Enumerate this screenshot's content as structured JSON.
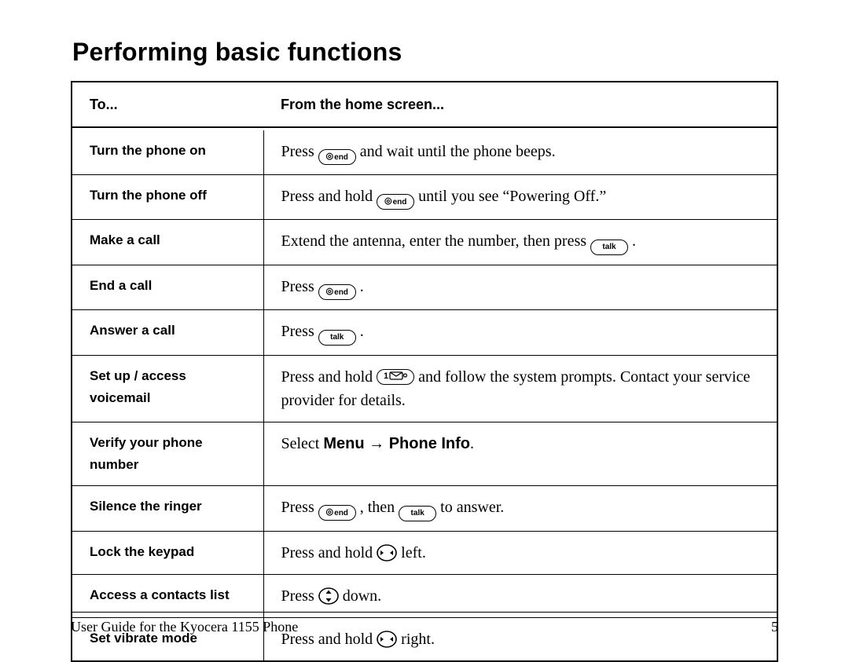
{
  "title": "Performing basic functions",
  "table": {
    "head": {
      "left": "To...",
      "right": "From the home screen..."
    },
    "rows": [
      {
        "lead": "Turn the phone on",
        "desc_pre": "Press ",
        "key1": "end",
        "desc_post": " and wait until the phone beeps."
      },
      {
        "lead": "Turn the phone off",
        "desc_pre": "Press and hold ",
        "key1": "end",
        "desc_post": " until you see “Powering Off.”"
      },
      {
        "lead": "Make a call",
        "desc_pre": "Extend the antenna, enter the number, then press ",
        "key1": "talk",
        "desc_post": " ."
      },
      {
        "lead": "End a call",
        "desc_pre": "Press ",
        "key1": "end",
        "desc_post": " ."
      },
      {
        "lead": "Answer a call",
        "desc_pre": "Press ",
        "key1": "talk",
        "desc_post": " ."
      },
      {
        "lead": "Set up / access voicemail",
        "desc_pre": "Press and hold ",
        "key1": "msg",
        "desc_post": " and follow the system prompts. Contact your service provider for details."
      },
      {
        "lead": "Verify your phone number",
        "plain_pre": "Select ",
        "bold": "Menu → Phone Info",
        "plain_post": "."
      },
      {
        "lead": "Silence the ringer",
        "desc_pre": "Press ",
        "key1": "end",
        "mid": " , then ",
        "key2": "talk",
        "desc_post": " to answer."
      },
      {
        "lead": "Lock the keypad",
        "desc_pre": "Press and hold ",
        "nav": "lr",
        "desc_post": " left."
      },
      {
        "lead": "Access a contacts list",
        "desc_pre": "Press ",
        "nav": "ud",
        "desc_post": " down."
      },
      {
        "lead": "Set vibrate mode",
        "desc_pre": "Press and hold ",
        "nav": "lr",
        "desc_post": " right."
      }
    ]
  },
  "footer": {
    "left": "User Guide for the Kyocera 1155 Phone",
    "right": "5"
  },
  "keys": {
    "end": "end",
    "talk": "talk"
  }
}
